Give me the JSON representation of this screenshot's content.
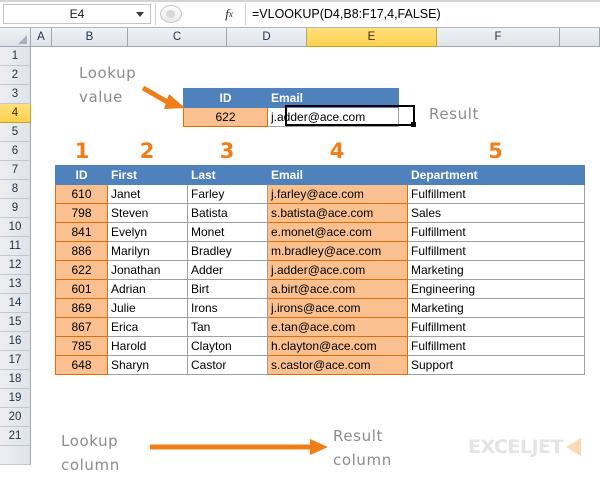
{
  "formula_bar": {
    "name_box_value": "E4",
    "formula": "=VLOOKUP(D4,B8:F17,4,FALSE)",
    "fx_label": "fx",
    "insert_function_name": "insert-function"
  },
  "grid": {
    "column_headers": [
      "A",
      "B",
      "C",
      "D",
      "E",
      "F"
    ],
    "selected_column": "E",
    "row_headers": [
      "1",
      "2",
      "3",
      "4",
      "5",
      "6",
      "7",
      "8",
      "9",
      "10",
      "11",
      "12",
      "13",
      "14",
      "15",
      "16",
      "17",
      "18",
      "19",
      "20",
      "21"
    ],
    "selected_row": "4"
  },
  "lookup_table": {
    "headers": [
      "ID",
      "Email"
    ],
    "row": {
      "id": "622",
      "email": "j.adder@ace.com"
    }
  },
  "data_table": {
    "step_numbers": [
      "1",
      "2",
      "3",
      "4",
      "5"
    ],
    "headers": [
      "ID",
      "First",
      "Last",
      "Email",
      "Department"
    ],
    "rows": [
      [
        "610",
        "Janet",
        "Farley",
        "j.farley@ace.com",
        "Fulfillment"
      ],
      [
        "798",
        "Steven",
        "Batista",
        "s.batista@ace.com",
        "Sales"
      ],
      [
        "841",
        "Evelyn",
        "Monet",
        "e.monet@ace.com",
        "Fulfillment"
      ],
      [
        "886",
        "Marilyn",
        "Bradley",
        "m.bradley@ace.com",
        "Fulfillment"
      ],
      [
        "622",
        "Jonathan",
        "Adder",
        "j.adder@ace.com",
        "Marketing"
      ],
      [
        "601",
        "Adrian",
        "Birt",
        "a.birt@ace.com",
        "Engineering"
      ],
      [
        "869",
        "Julie",
        "Irons",
        "j.irons@ace.com",
        "Marketing"
      ],
      [
        "867",
        "Erica",
        "Tan",
        "e.tan@ace.com",
        "Fulfillment"
      ],
      [
        "785",
        "Harold",
        "Clayton",
        "h.clayton@ace.com",
        "Fulfillment"
      ],
      [
        "648",
        "Sharyn",
        "Castor",
        "s.castor@ace.com",
        "Support"
      ]
    ]
  },
  "annotations": {
    "lookup_value_line1": "Lookup",
    "lookup_value_line2": "value",
    "result_label": "Result",
    "lookup_column_line1": "Lookup",
    "lookup_column_line2": "column",
    "result_column_line1": "Result",
    "result_column_line2": "column"
  },
  "watermark": {
    "text": "EXCELJET"
  },
  "colors": {
    "header_blue": "#4f81bd",
    "fill_orange": "#fac090",
    "accent_orange": "#f07d18",
    "selection_yellow": "#ffd04f"
  }
}
